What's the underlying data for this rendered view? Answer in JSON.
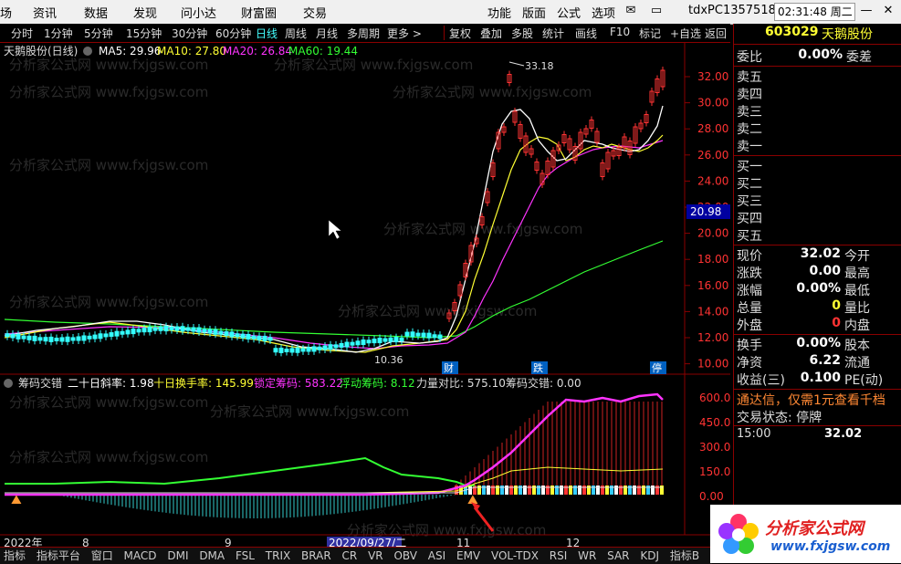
{
  "menu": {
    "left_items": [
      "场",
      "资讯",
      "数据",
      "发现",
      "问小达",
      "财富圈",
      "交易"
    ],
    "right_items": [
      "功能",
      "版面",
      "公式",
      "选项"
    ],
    "account": "tdxPC1357518",
    "clock": "02:31:48 周二"
  },
  "toolbar": {
    "periods": [
      "分时",
      "1分钟",
      "5分钟",
      "15分钟",
      "30分钟",
      "60分钟",
      "日线",
      "周线",
      "月线",
      "多周期",
      "更多 >"
    ],
    "active_period": "日线",
    "tools": [
      "复权",
      "叠加",
      "多股",
      "统计",
      "画线",
      "F10",
      "标记",
      "+自选",
      "返回"
    ]
  },
  "main_panel": {
    "stock_title": "天鹅股份(日线)",
    "ma_labels": [
      {
        "text": "MA5: 29.96",
        "color": "#ffffff"
      },
      {
        "text": "MA10: 27.80",
        "color": "#ffff33"
      },
      {
        "text": "MA20: 26.84",
        "color": "#ff33ff"
      },
      {
        "text": "MA60: 19.44",
        "color": "#33ff33"
      }
    ],
    "high_label": "33.18",
    "low_label": "10.36",
    "price_marker": "20.98",
    "markers": [
      "财",
      "跌",
      "停"
    ],
    "y_ticks": [
      "32.00",
      "30.00",
      "28.00",
      "26.00",
      "24.00",
      "22.00",
      "20.00",
      "18.00",
      "16.00",
      "14.00",
      "12.00",
      "10.00"
    ]
  },
  "sub_panel": {
    "title": "筹码交错",
    "indicators": [
      {
        "text": "二十日斜率: 1.98",
        "color": "#ffffff"
      },
      {
        "text": "十日换手率: 145.99",
        "color": "#ffff33"
      },
      {
        "text": "锁定筹码: 583.22",
        "color": "#ff33ff"
      },
      {
        "text": "浮动筹码: 8.12",
        "color": "#33ff33"
      },
      {
        "text": "力量对比: 575.10",
        "color": "#dddddd"
      },
      {
        "text": "筹码交错: 0.00",
        "color": "#dddddd"
      }
    ],
    "y_ticks": [
      "600.0",
      "450.0",
      "300.0",
      "150.0",
      "0.00"
    ]
  },
  "bottom": {
    "date_labels": [
      "2022年",
      "8",
      "9",
      "2022/09/27/二",
      "11",
      "12"
    ],
    "tabs_partial": [
      "指标",
      "指标平台",
      "窗口",
      "MACD",
      "DMI",
      "DMA",
      "FSL",
      "TRIX",
      "BRAR",
      "CR",
      "VR",
      "OBV",
      "ASI",
      "EMV",
      "VOL-TDX",
      "RSI",
      "WR",
      "SAR",
      "KDJ",
      "指标B",
      "模板"
    ]
  },
  "quote_panel": {
    "code": "603029",
    "name": "天鹅股份",
    "wei_label": "委比",
    "wei_value": "0.00%",
    "wei_label2": "委差",
    "sell_levels": [
      "卖五",
      "卖四",
      "卖三",
      "卖二",
      "卖一"
    ],
    "buy_levels": [
      "买一",
      "买二",
      "买三",
      "买四",
      "买五"
    ],
    "stats": [
      {
        "label": "现价",
        "value": "32.02",
        "color": "#ffffff",
        "label2": "今开"
      },
      {
        "label": "涨跌",
        "value": "0.00",
        "color": "#ffffff",
        "label2": "最高"
      },
      {
        "label": "涨幅",
        "value": "0.00%",
        "color": "#ffffff",
        "label2": "最低"
      },
      {
        "label": "总量",
        "value": "0",
        "color": "#ffff33",
        "label2": "量比"
      },
      {
        "label": "外盘",
        "value": "0",
        "color": "#ff3333",
        "label2": "内盘"
      }
    ],
    "stats2": [
      {
        "label": "换手",
        "value": "0.00%",
        "color": "#ffffff",
        "label2": "股本"
      },
      {
        "label": "净资",
        "value": "6.22",
        "color": "#ffffff",
        "label2": "流通"
      },
      {
        "label": "收益(三)",
        "value": "0.100",
        "color": "#ffffff",
        "label2": "PE(动)"
      }
    ],
    "notice": "通达信，仅需1元查看千档",
    "trade_status": "交易状态: 停牌",
    "tick_time": "15:00",
    "tick_price": "32.02"
  },
  "logo": {
    "name": "分析家公式网",
    "url": "www.fxjgsw.com"
  },
  "colors": {
    "up": "#ff3333",
    "down": "#33ffff",
    "grid": "#8a0000",
    "ma5": "#ffffff",
    "ma10": "#ffff33",
    "ma20": "#ff33ff",
    "ma60": "#33ff33"
  }
}
